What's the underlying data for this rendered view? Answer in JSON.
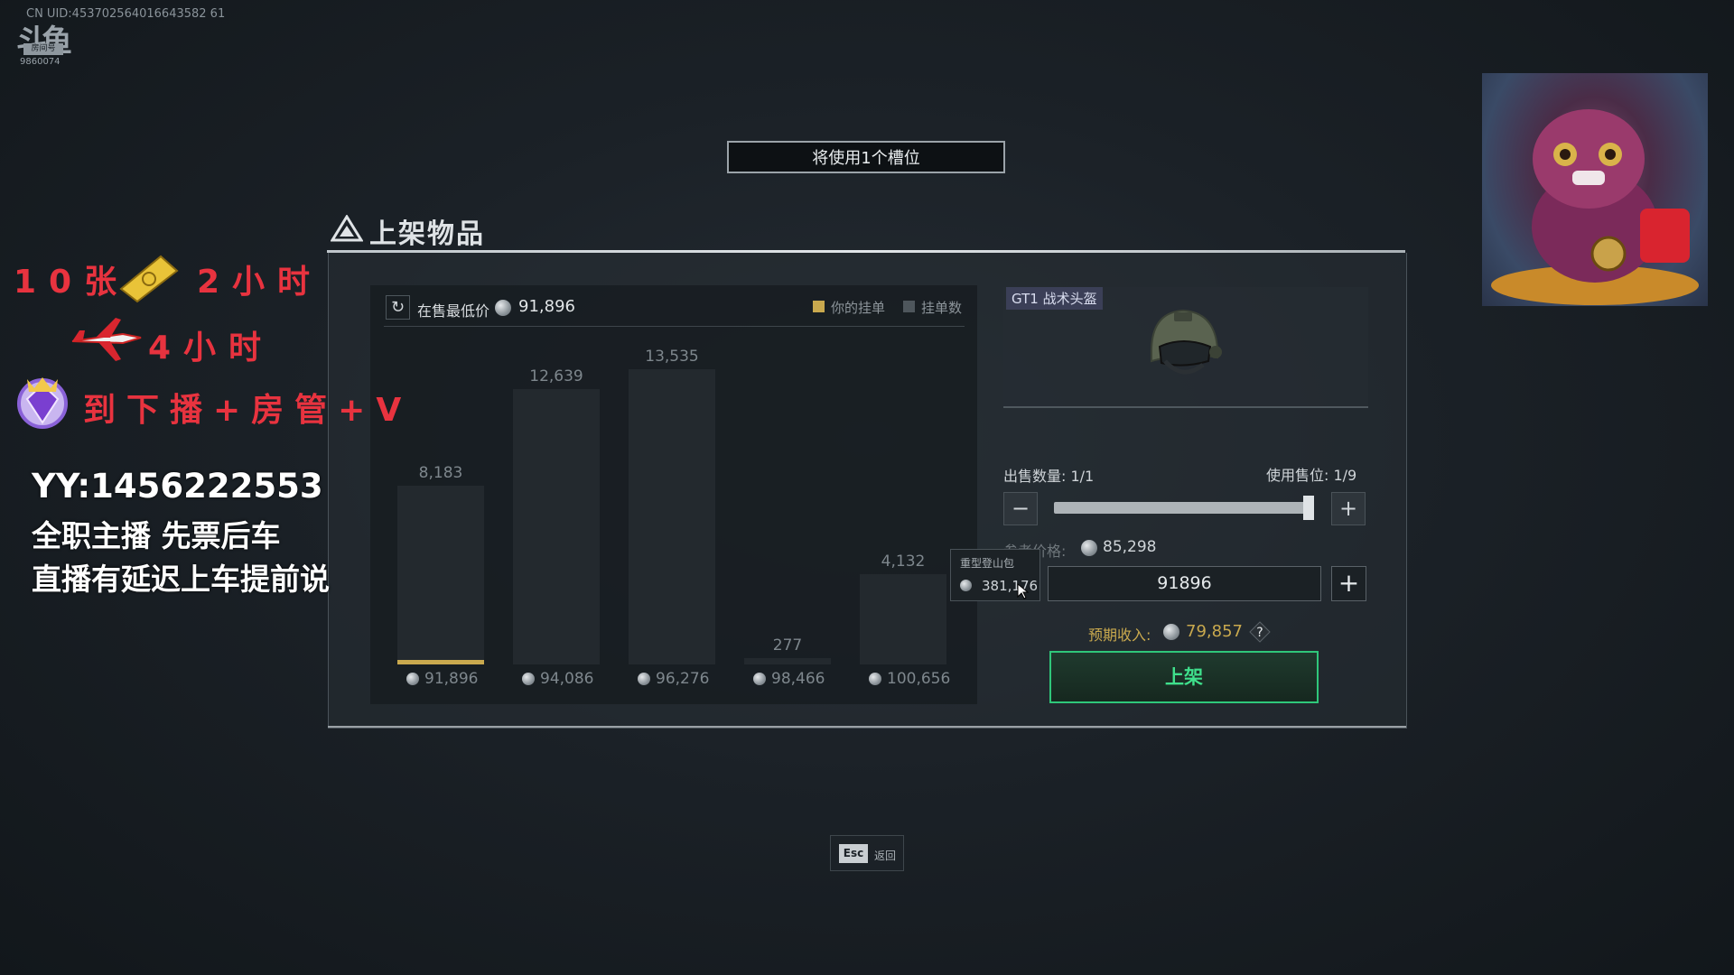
{
  "watermark": {
    "uid": "CN UID:453702564016643582 61",
    "logo_tag": "房间号",
    "room": "9860074"
  },
  "slot_banner": "将使用1个槽位",
  "dialog": {
    "title": "上架物品"
  },
  "chart": {
    "lowest_label": "在售最低价",
    "lowest_value": "91,896",
    "legend_yours": "你的挂单",
    "legend_count": "挂单数"
  },
  "chart_data": {
    "type": "bar",
    "categories": [
      "91,896",
      "94,086",
      "96,276",
      "98,466",
      "100,656"
    ],
    "series": [
      {
        "name": "挂单数",
        "values": [
          8183,
          12639,
          13535,
          277,
          4132
        ]
      }
    ],
    "labels": [
      "8,183",
      "12,639",
      "13,535",
      "277",
      "4,132"
    ],
    "your_listing_index": 0,
    "ylim": [
      0,
      14500
    ],
    "colors": {
      "bar": "#23292e",
      "yours": "#c9a94e"
    }
  },
  "item": {
    "name": "GT1 战术头盔",
    "icon": "helmet-icon"
  },
  "sale": {
    "qty_label": "出售数量: 1/1",
    "slot_label": "使用售位: 1/9",
    "quantity_fraction": 1.0,
    "ref_label": "参考价格:",
    "ref_value": "85,298",
    "price_input": "91896",
    "income_label": "预期收入:",
    "income_value": "79,857",
    "list_button": "上架"
  },
  "tooltip": {
    "name": "重型登山包",
    "value": "381,176"
  },
  "esc": {
    "key": "Esc",
    "label": "返回"
  },
  "promo": {
    "line1a": "10张",
    "line1b": "2小时",
    "line2": "4小时",
    "line3": "到下播+房管+V",
    "yy": "YY:1456222553",
    "fulltime": "全职主播 先票后车",
    "delay": "直播有延迟上车提前说"
  },
  "colors": {
    "accent_gold": "#c9a94e",
    "accent_green": "#2fc77a",
    "promo_red": "#e8333f"
  }
}
